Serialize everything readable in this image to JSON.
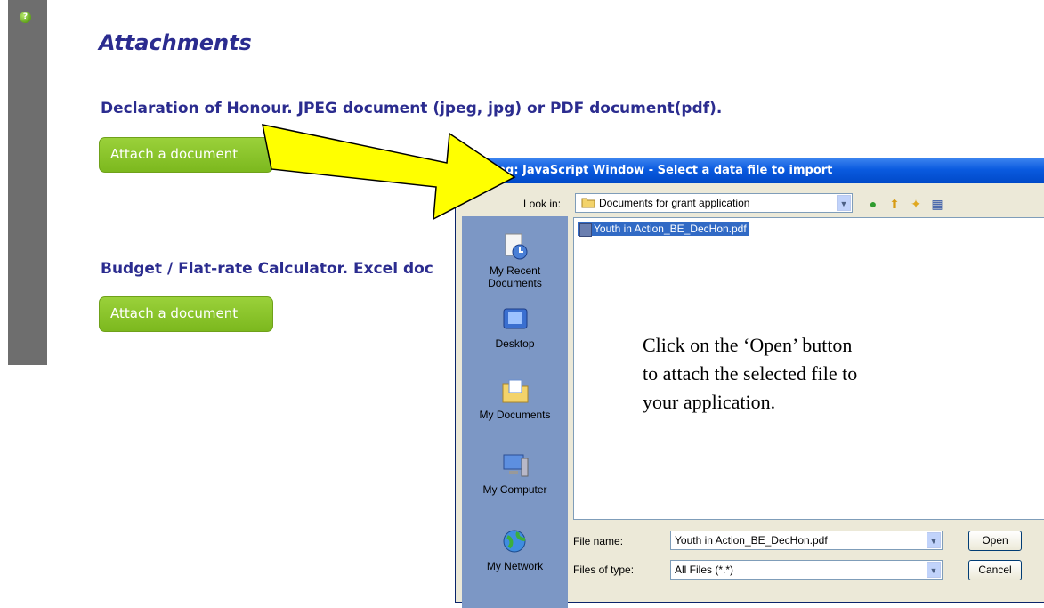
{
  "page": {
    "title": "Attachments",
    "sections": [
      {
        "heading": "Declaration of Honour.  JPEG document (jpeg, jpg) or PDF document(pdf).",
        "button_label": "Attach a document"
      },
      {
        "heading": "Budget / Flat-rate Calculator. Excel doc",
        "button_label": "Attach a document"
      }
    ],
    "help_glyph": "?"
  },
  "dialog": {
    "title": "Warning: JavaScript Window - Select a data file to import",
    "look_in_label": "Look in:",
    "look_in_value": "Documents for grant application",
    "places": [
      {
        "label": "My Recent Documents",
        "icon": "recent-documents-icon"
      },
      {
        "label": "Desktop",
        "icon": "desktop-icon"
      },
      {
        "label": "My Documents",
        "icon": "my-documents-icon"
      },
      {
        "label": "My Computer",
        "icon": "my-computer-icon"
      },
      {
        "label": "My Network",
        "icon": "my-network-icon"
      }
    ],
    "files": [
      "Youth in Action_BE_DecHon.pdf"
    ],
    "file_name_label": "File name:",
    "file_name_value": "Youth in Action_BE_DecHon.pdf",
    "file_type_label": "Files of type:",
    "file_type_value": "All Files (*.*)",
    "open_label": "Open",
    "cancel_label": "Cancel"
  },
  "annotation": {
    "text_line1": "Click on the ‘Open’ button",
    "text_line2": "to attach the selected file to",
    "text_line3": "your application."
  },
  "colors": {
    "heading": "#2b2c8f",
    "button": "#8cc63f",
    "arrow": "#ffff00",
    "titlebar": "#0a5adf"
  }
}
